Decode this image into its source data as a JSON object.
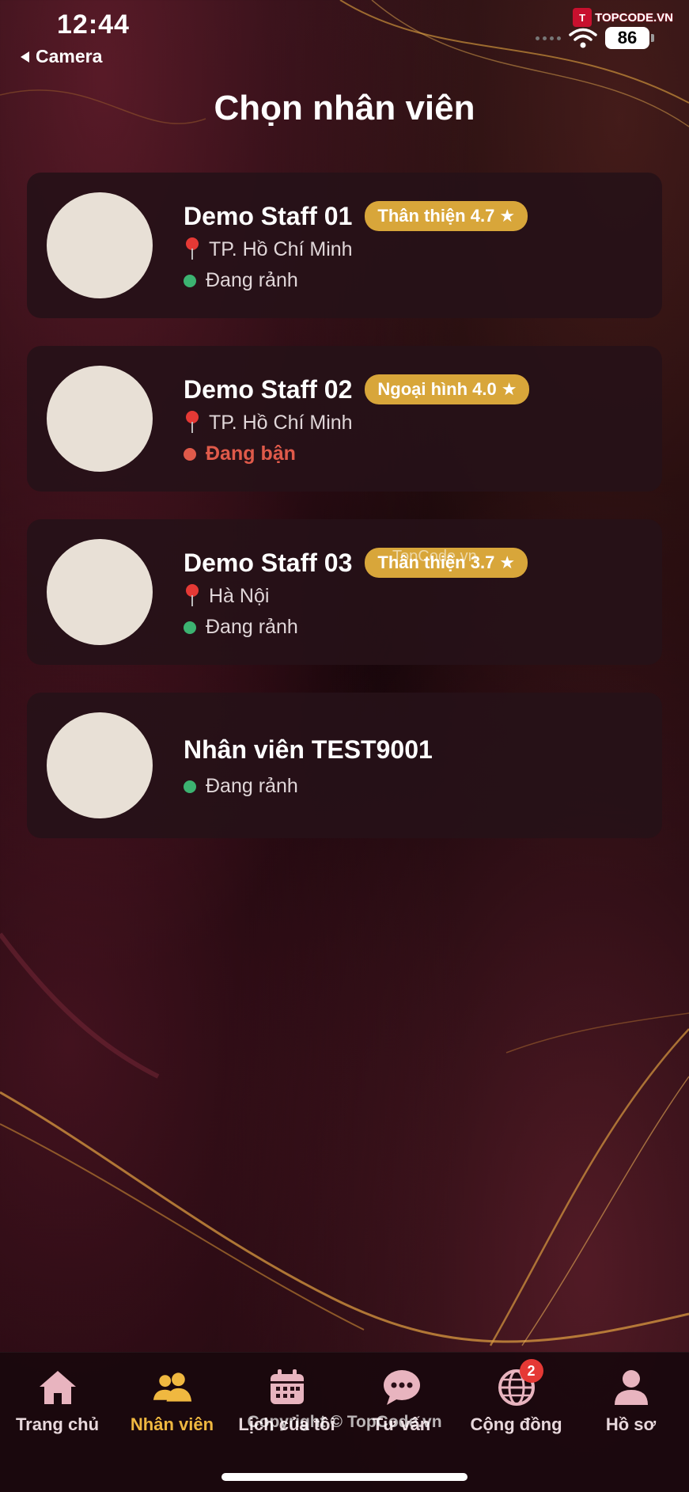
{
  "status_bar": {
    "time": "12:44",
    "back_label": "Camera",
    "battery": "86",
    "watermark": "TOPCODE.VN",
    "watermark_badge": "T"
  },
  "page": {
    "title": "Chọn nhân viên"
  },
  "staff": [
    {
      "name": "Demo Staff 01",
      "badge": "Thân thiện 4.7",
      "location": "TP. Hồ Chí Minh",
      "status": "Đang rảnh",
      "status_type": "available"
    },
    {
      "name": "Demo Staff 02",
      "badge": "Ngoại hình 4.0",
      "location": "TP. Hồ Chí Minh",
      "status": "Đang bận",
      "status_type": "busy"
    },
    {
      "name": "Demo Staff 03",
      "badge": "Thân thiện 3.7",
      "location": "Hà Nội",
      "status": "Đang rảnh",
      "status_type": "available"
    },
    {
      "name": "Nhân viên TEST9001",
      "status": "Đang rảnh",
      "status_type": "available"
    }
  ],
  "overlay_watermark": "TopCode.vn",
  "bottom_nav": {
    "items": [
      {
        "label": "Trang chủ",
        "icon": "home-icon"
      },
      {
        "label": "Nhân viên",
        "icon": "staff-icon",
        "active": true
      },
      {
        "label": "Lịch của tôi",
        "icon": "calendar-icon"
      },
      {
        "label": "Tư vấn",
        "icon": "chat-icon"
      },
      {
        "label": "Cộng đồng",
        "icon": "globe-icon",
        "badge": "2"
      },
      {
        "label": "Hồ sơ",
        "icon": "profile-icon"
      }
    ],
    "copyright": "Copyright © TopCode.vn"
  },
  "colors": {
    "accent_gold": "#d8a63a",
    "active_label": "#f0b840",
    "available": "#3cb371",
    "busy": "#e05a4a",
    "card_bg": "#261118"
  }
}
